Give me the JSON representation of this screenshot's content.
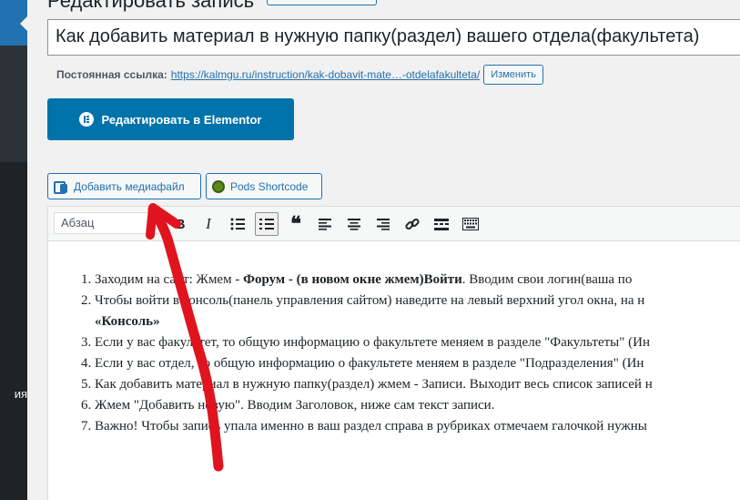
{
  "sidebar": {
    "menu_fragment": "ия"
  },
  "header": {
    "title": "Редактировать запись",
    "add_new_label": ""
  },
  "post": {
    "title_value": "Как добавить материал в нужную папку(раздел) вашего отдела(факультета)"
  },
  "permalink": {
    "label": "Постоянная ссылка:",
    "url_base": "https://kalmgu.ru/instruction/",
    "slug": "kak-dobavit-mate…-otdelafakulteta",
    "url_end": "/",
    "edit_label": "Изменить"
  },
  "elementor": {
    "button_label": "Редактировать в Elementor"
  },
  "media": {
    "add_media_label": "Добавить медиафайл",
    "pods_label": "Pods Shortcode"
  },
  "toolbar": {
    "format_value": "Абзац",
    "bold": "B",
    "italic": "I",
    "quote": "❝"
  },
  "content": {
    "items": [
      {
        "plain_a": "Заходим на сайт: Жмем - ",
        "bold_a": "Форум - (в новом окне жмем)Войти",
        "plain_b": ". Вводим свои логин(ваша по"
      },
      {
        "plain_a": "Чтобы войти в консоль(панель управления сайтом) наведите на левый верхний угол окна, на н"
      },
      {
        "bold_a": "«Консоль»"
      },
      {
        "plain_a": "Если у вас факультет, то общую информацию о факультете меняем в разделе \"Факультеты\" (Ин"
      },
      {
        "plain_a": "Если у вас отдел, то общую информацию о факультете меняем в разделе \"Подразделения\" (Ин"
      },
      {
        "plain_a": "Как добавить материал в нужную папку(раздел) жмем - Записи. Выходит весь список записей н"
      },
      {
        "plain_a": "Жмем \"Добавить новую\". Вводим Заголовок, ниже сам текст записи."
      },
      {
        "plain_a": "Важно! Чтобы запись упала именно в ваш раздел справа в рубриках отмечаем галочкой нужны"
      }
    ]
  },
  "colors": {
    "admin_blue": "#2271b1",
    "elementor_blue": "#0073aa",
    "sidebar_dark": "#1d2327",
    "arrow_red": "#e0141e"
  }
}
